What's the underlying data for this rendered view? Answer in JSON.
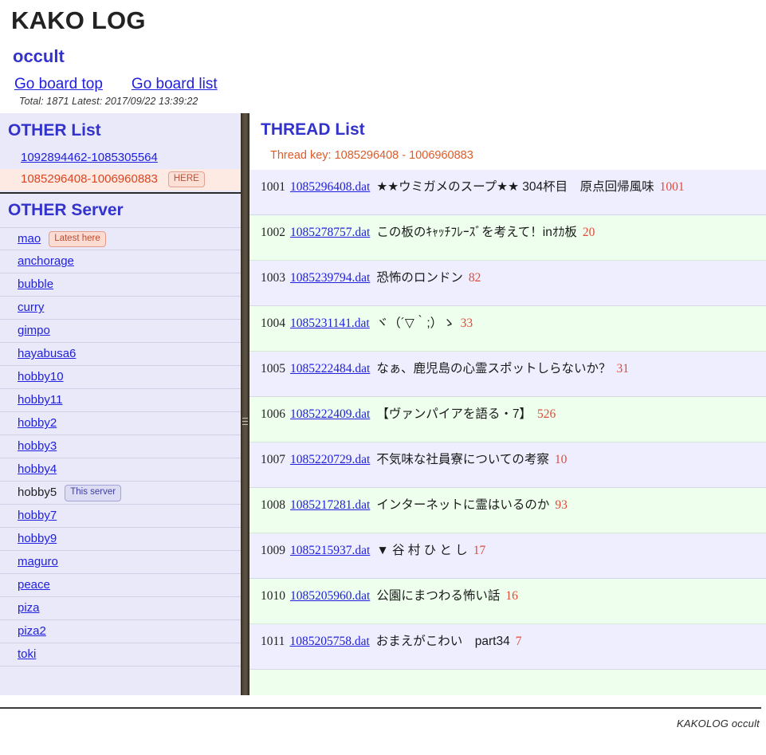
{
  "header": {
    "site_title": "KAKO LOG",
    "board_name": "occult",
    "link_board_top": "Go board top",
    "link_board_list": "Go board list",
    "meta": "Total: 1871 Latest: 2017/09/22 13:39:22"
  },
  "other_list": {
    "title": "OTHER List",
    "items": [
      {
        "label": "1092894462-1085305564",
        "current": false,
        "badge": ""
      },
      {
        "label": "1085296408-1006960883",
        "current": true,
        "badge": "HERE"
      }
    ]
  },
  "other_server": {
    "title": "OTHER Server",
    "items": [
      {
        "label": "mao",
        "badge": "Latest here",
        "badge_kind": "latest",
        "is_link": true
      },
      {
        "label": "anchorage",
        "badge": "",
        "badge_kind": "",
        "is_link": true
      },
      {
        "label": "bubble",
        "badge": "",
        "badge_kind": "",
        "is_link": true
      },
      {
        "label": "curry",
        "badge": "",
        "badge_kind": "",
        "is_link": true
      },
      {
        "label": "gimpo",
        "badge": "",
        "badge_kind": "",
        "is_link": true
      },
      {
        "label": "hayabusa6",
        "badge": "",
        "badge_kind": "",
        "is_link": true
      },
      {
        "label": "hobby10",
        "badge": "",
        "badge_kind": "",
        "is_link": true
      },
      {
        "label": "hobby11",
        "badge": "",
        "badge_kind": "",
        "is_link": true
      },
      {
        "label": "hobby2",
        "badge": "",
        "badge_kind": "",
        "is_link": true
      },
      {
        "label": "hobby3",
        "badge": "",
        "badge_kind": "",
        "is_link": true
      },
      {
        "label": "hobby4",
        "badge": "",
        "badge_kind": "",
        "is_link": true
      },
      {
        "label": "hobby5",
        "badge": "This server",
        "badge_kind": "thisserver",
        "is_link": false
      },
      {
        "label": "hobby7",
        "badge": "",
        "badge_kind": "",
        "is_link": true
      },
      {
        "label": "hobby9",
        "badge": "",
        "badge_kind": "",
        "is_link": true
      },
      {
        "label": "maguro",
        "badge": "",
        "badge_kind": "",
        "is_link": true
      },
      {
        "label": "peace",
        "badge": "",
        "badge_kind": "",
        "is_link": true
      },
      {
        "label": "piza",
        "badge": "",
        "badge_kind": "",
        "is_link": true
      },
      {
        "label": "piza2",
        "badge": "",
        "badge_kind": "",
        "is_link": true
      },
      {
        "label": "toki",
        "badge": "",
        "badge_kind": "",
        "is_link": true
      }
    ]
  },
  "threads": {
    "title": "THREAD List",
    "key_line": "Thread key: 1085296408 - 1006960883",
    "rows": [
      {
        "num": "1001",
        "file": "1085296408.dat",
        "subject": "★★ウミガメのスープ★★ 304杯目　原点回帰風味",
        "count": "1001"
      },
      {
        "num": "1002",
        "file": "1085278757.dat",
        "subject": "この板のｷｬｯﾁﾌﾚｰｽﾞを考えて！inｵｶ板",
        "count": "20"
      },
      {
        "num": "1003",
        "file": "1085239794.dat",
        "subject": "恐怖のロンドン",
        "count": "82"
      },
      {
        "num": "1004",
        "file": "1085231141.dat",
        "subject": "ヾ（´▽｀;）ゝ",
        "count": "33"
      },
      {
        "num": "1005",
        "file": "1085222484.dat",
        "subject": "なぁ、鹿児島の心霊スポットしらないか？",
        "count": "31"
      },
      {
        "num": "1006",
        "file": "1085222409.dat",
        "subject": "【ヴァンパイアを語る・7】",
        "count": "526"
      },
      {
        "num": "1007",
        "file": "1085220729.dat",
        "subject": "不気味な社員寮についての考察",
        "count": "10"
      },
      {
        "num": "1008",
        "file": "1085217281.dat",
        "subject": "インターネットに霊はいるのか",
        "count": "93"
      },
      {
        "num": "1009",
        "file": "1085215937.dat",
        "subject": "▼ 谷 村 ひ と し",
        "count": "17"
      },
      {
        "num": "1010",
        "file": "1085205960.dat",
        "subject": "公園にまつわる怖い話",
        "count": "16"
      },
      {
        "num": "1011",
        "file": "1085205758.dat",
        "subject": "おまえがこわい　part34",
        "count": "7"
      },
      {
        "num": "",
        "file": "",
        "subject": "",
        "count": ""
      }
    ]
  },
  "footer": {
    "text": "KAKOLOG occult"
  },
  "colors": {
    "accent_blue": "#3333cc",
    "link_blue": "#2020dd",
    "count_red": "#e04a3a",
    "key_orange": "#e05a28",
    "row_lavender": "#eeeeff",
    "row_green": "#eeffee",
    "sidebar_bg": "#e9e9fa",
    "current_bg": "#fdeae3",
    "splitter": "#554c3d"
  }
}
